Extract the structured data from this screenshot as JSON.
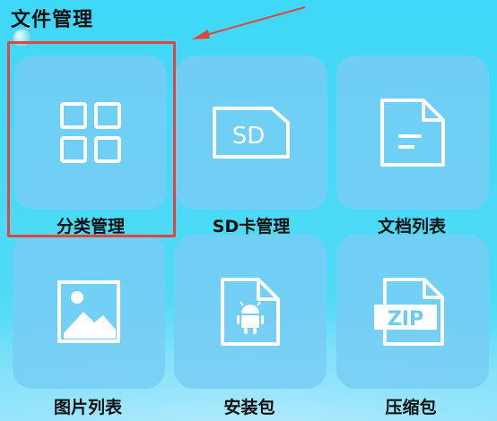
{
  "header": {
    "title": "文件管理"
  },
  "tiles": [
    {
      "label": "分类管理",
      "icon": "category-grid-icon"
    },
    {
      "label": "SD卡管理",
      "icon": "sd-card-icon",
      "icon_text": "SD"
    },
    {
      "label": "文档列表",
      "icon": "document-icon"
    },
    {
      "label": "图片列表",
      "icon": "image-icon"
    },
    {
      "label": "安装包",
      "icon": "android-apk-icon"
    },
    {
      "label": "压缩包",
      "icon": "zip-archive-icon",
      "icon_text": "ZIP"
    }
  ],
  "annotation": {
    "highlight_color": "#e0463f"
  },
  "colors": {
    "background": "#4ad6f5",
    "tile": "#78cdf5",
    "icon": "#ffffff"
  }
}
